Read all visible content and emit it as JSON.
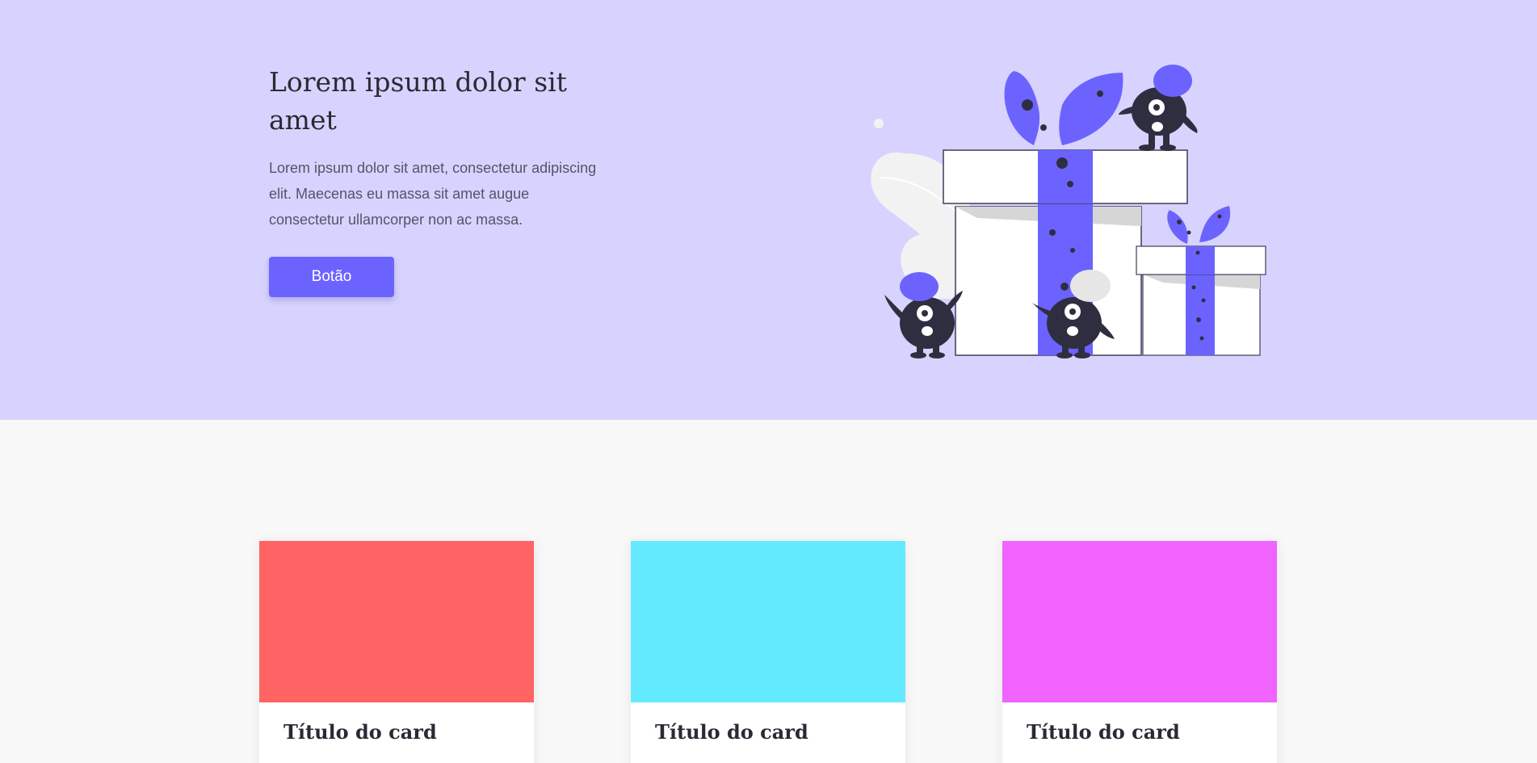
{
  "hero": {
    "title": "Lorem ipsum dolor sit amet",
    "body": "Lorem ipsum dolor sit amet, consectetur adipiscing elit. Maecenas eu massa sit amet augue consectetur ullamcorper non ac massa.",
    "button_label": "Botão",
    "background_color": "#d7d3fe",
    "accent_color": "#6c63ff"
  },
  "illustration": {
    "subject": "gift-boxes-with-monsters"
  },
  "cards": [
    {
      "title": "Título do card",
      "media_color": "#ff6363"
    },
    {
      "title": "Título do card",
      "media_color": "#63eaff"
    },
    {
      "title": "Título do card",
      "media_color": "#f063ff"
    }
  ]
}
